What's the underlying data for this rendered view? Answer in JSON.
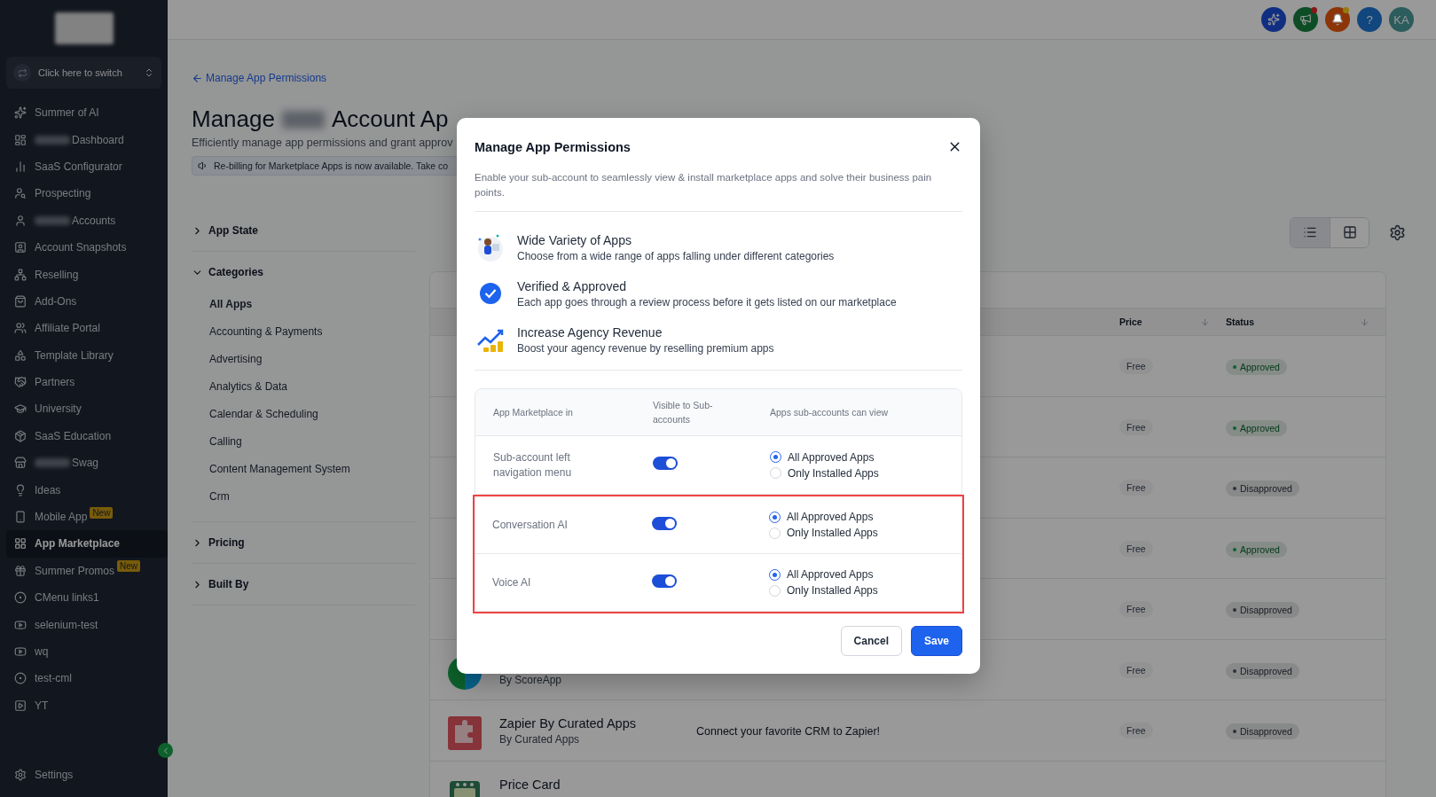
{
  "sidebar": {
    "switcher": {
      "label": "Click here to switch"
    },
    "items": [
      {
        "label": "Summer of AI",
        "selected": false,
        "blurred_prefix": false
      },
      {
        "label": "Dashboard",
        "selected": false,
        "blurred_prefix": true
      },
      {
        "label": "SaaS Configurator",
        "selected": false,
        "blurred_prefix": false
      },
      {
        "label": "Prospecting",
        "selected": false,
        "blurred_prefix": false
      },
      {
        "label": "Accounts",
        "selected": false,
        "blurred_prefix": true
      },
      {
        "label": "Account Snapshots",
        "selected": false,
        "blurred_prefix": false
      },
      {
        "label": "Reselling",
        "selected": false,
        "blurred_prefix": false
      },
      {
        "label": "Add-Ons",
        "selected": false,
        "blurred_prefix": false
      },
      {
        "label": "Affiliate Portal",
        "selected": false,
        "blurred_prefix": false
      },
      {
        "label": "Template Library",
        "selected": false,
        "blurred_prefix": false
      },
      {
        "label": "Partners",
        "selected": false,
        "blurred_prefix": false
      },
      {
        "label": "University",
        "selected": false,
        "blurred_prefix": false
      },
      {
        "label": "SaaS Education",
        "selected": false,
        "blurred_prefix": false
      },
      {
        "label": "Swag",
        "selected": false,
        "blurred_prefix": true
      },
      {
        "label": "Ideas",
        "selected": false,
        "blurred_prefix": false
      },
      {
        "label": "Mobile App",
        "selected": false,
        "blurred_prefix": false,
        "badge": "New"
      },
      {
        "label": "App Marketplace",
        "selected": true,
        "blurred_prefix": false
      },
      {
        "label": "Summer Promos",
        "selected": false,
        "blurred_prefix": false,
        "badge": "New"
      },
      {
        "label": "CMenu links1",
        "selected": false,
        "blurred_prefix": false
      },
      {
        "label": "selenium-test",
        "selected": false,
        "blurred_prefix": false
      },
      {
        "label": "wq",
        "selected": false,
        "blurred_prefix": false
      },
      {
        "label": "test-cml",
        "selected": false,
        "blurred_prefix": false
      },
      {
        "label": "YT",
        "selected": false,
        "blurred_prefix": false
      }
    ],
    "settings": {
      "label": "Settings"
    }
  },
  "header": {
    "buttons": [
      {
        "kind": "sparkle",
        "color": "#112f82"
      },
      {
        "kind": "megaphone",
        "color": "#0d4d25",
        "badge": {
          "color": "#841717"
        }
      },
      {
        "kind": "bell",
        "color": "#8c3507",
        "badge": {
          "color": "#967a0d"
        }
      },
      {
        "kind": "help",
        "color": "#11477e",
        "text": "?"
      },
      {
        "kind": "avatar",
        "color": "#2c5c5c",
        "text": "KA"
      }
    ]
  },
  "page": {
    "back_link": "Manage App Permissions",
    "title_start": "Manage",
    "title_end": "Account Ap",
    "subtitle": "Efficiently manage app permissions and grant approv",
    "banner": "Re-billing for Marketplace Apps is now available. Take co"
  },
  "filters": [
    {
      "label": "App State",
      "expanded": false
    },
    {
      "label": "Categories",
      "expanded": true,
      "children": [
        {
          "label": "All Apps",
          "selected": true
        },
        {
          "label": "Accounting & Payments",
          "selected": false
        },
        {
          "label": "Advertising",
          "selected": false
        },
        {
          "label": "Analytics & Data",
          "selected": false
        },
        {
          "label": "Calendar & Scheduling",
          "selected": false
        },
        {
          "label": "Calling",
          "selected": false
        },
        {
          "label": "Content Management System",
          "selected": false
        },
        {
          "label": "Crm",
          "selected": false
        }
      ]
    },
    {
      "label": "Pricing",
      "expanded": false
    },
    {
      "label": "Built By",
      "expanded": false
    }
  ],
  "table": {
    "columns": [
      "Price",
      "Status"
    ],
    "rows": [
      {
        "price": "Free",
        "status": "Approved",
        "color": "#0d622c"
      },
      {
        "price": "Free",
        "status": "Approved",
        "color": "#0d622c"
      },
      {
        "price": "Free",
        "status": "Disapproved",
        "color": "#2d333b"
      },
      {
        "price": "Free",
        "status": "Approved",
        "color": "#0d622c"
      },
      {
        "price": "Free",
        "status": "Disapproved",
        "color": "#2d333b"
      },
      {
        "by": "By ScoreApp",
        "price": "Free",
        "status": "Disapproved",
        "color": "#2d333b"
      },
      {
        "name": "Zapier By Curated Apps",
        "by": "By Curated Apps",
        "description": "Connect your favorite CRM to Zapier!",
        "price": "Free",
        "status": "Disapproved",
        "color": "#2d333b"
      },
      {
        "name": "Price Card"
      }
    ]
  },
  "modal": {
    "title": "Manage App Permissions",
    "description": "Enable your sub-account to seamlessly view & install marketplace apps and solve their business pain points.",
    "features": [
      {
        "title": "Wide Variety of Apps",
        "text": "Choose from a wide range of apps falling under different categories"
      },
      {
        "title": "Verified & Approved",
        "text": "Each app goes through a review process before it gets listed on our marketplace"
      },
      {
        "title": "Increase Agency Revenue",
        "text": "Boost your agency revenue by reselling premium apps"
      }
    ],
    "columns": [
      "App Marketplace in",
      "Visible to Sub-accounts",
      "Apps sub-accounts can view"
    ],
    "rows": [
      {
        "name": "Sub-account left navigation menu",
        "on": true,
        "highlighted": false,
        "options": [
          {
            "label": "All Approved Apps",
            "selected": true
          },
          {
            "label": "Only Installed Apps",
            "selected": false
          }
        ]
      },
      {
        "name": "Conversation AI",
        "on": true,
        "highlighted": true,
        "options": [
          {
            "label": "All Approved Apps",
            "selected": true
          },
          {
            "label": "Only Installed Apps",
            "selected": false
          }
        ]
      },
      {
        "name": "Voice AI",
        "on": true,
        "highlighted": true,
        "options": [
          {
            "label": "All Approved Apps",
            "selected": true
          },
          {
            "label": "Only Installed Apps",
            "selected": false
          }
        ]
      }
    ],
    "buttons": [
      {
        "label": "Cancel",
        "kind": "secondary"
      },
      {
        "label": "Save",
        "kind": "primary"
      }
    ]
  }
}
